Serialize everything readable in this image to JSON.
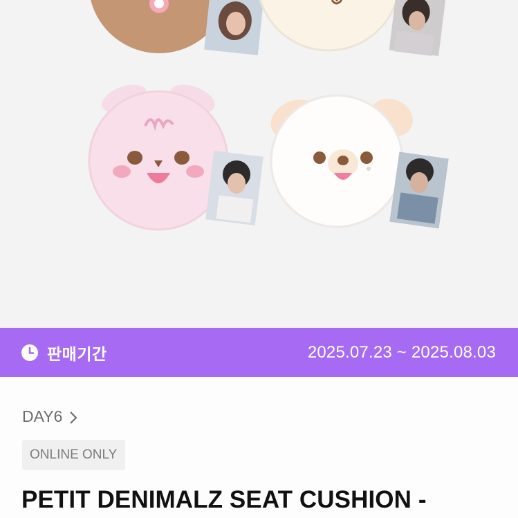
{
  "sale": {
    "label": "판매기간",
    "dates": "2025.07.23 ~ 2025.08.03",
    "bar_color": "#a66bf2"
  },
  "product": {
    "artist": "DAY6",
    "badge": "ONLINE ONLY",
    "title": "PETIT DENIMALZ SEAT CUSHION -"
  },
  "icons": {
    "sale": "clock-icon",
    "artist": "chevron-right-icon"
  }
}
